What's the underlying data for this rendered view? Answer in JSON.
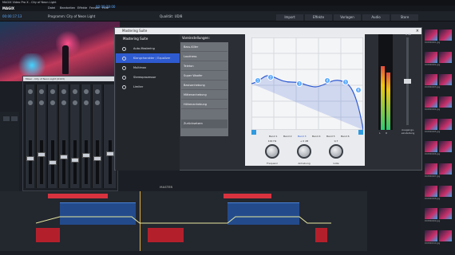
{
  "window": {
    "title": "MAGIX Video Pro X - City of Neon Light",
    "brand": "MAGIX"
  },
  "menu": [
    "Datei",
    "Bearbeiten",
    "Effekte",
    "Fenster",
    "Hilfe"
  ],
  "transport": {
    "timecode_left": "00:00:17:13",
    "program_label": "Programm: City of Neon Light",
    "quality_label": "Qualität: UD/8",
    "timecode_right": "00:00:38:00"
  },
  "top_tabs": [
    "Import",
    "Effekte",
    "Vorlagen",
    "Audio",
    "Store"
  ],
  "mixer": {
    "title": "Mixer - City of Neon Light (0103)",
    "master_label": "MASTER"
  },
  "dialog": {
    "title": "Mastering Suite",
    "nav": [
      {
        "label": "Auto-Mastering",
        "active": false
      },
      {
        "label": "Klangcharakter / Equalizer",
        "active": true
      },
      {
        "label": "Multimax",
        "active": false
      },
      {
        "label": "Stereoprozessor",
        "active": false
      },
      {
        "label": "Limiter",
        "active": false
      }
    ],
    "presets_title": "Voreinstellungen:",
    "presets": [
      "Bass-Killer",
      "Loudness",
      "Teleton",
      "Super Woofer",
      "Basisanhebung",
      "Mittenanhebung",
      "Höhenanhebung",
      "Zurücksetzen"
    ],
    "bands": [
      "Band 1",
      "Band 2",
      "Band 3",
      "Band 4",
      "Band 5",
      "Band 6"
    ],
    "points": [
      "1",
      "2",
      "3",
      "4",
      "5",
      "6"
    ],
    "knobs": [
      {
        "value": "100 Hz",
        "label": "Frequenz"
      },
      {
        "value": "+ 0 dB",
        "label": "Anhebung"
      },
      {
        "value": "0,7",
        "label": "Güte"
      }
    ],
    "meter_top": "0 dB",
    "meter_label": "Ausgangs-einstellung",
    "meter_channels": [
      "L",
      "R"
    ]
  },
  "media": [
    "DCIM00001.jpg",
    "DCIM00002.jpg",
    "DCIM00003.jpg",
    "DCIM00004.jpg",
    "DCIM00005.jpg",
    "DCIM00006.jpg",
    "DCIM00007.jpg",
    "DCIM00008.jpg",
    "DCIM00009.jpg",
    "DCIM00010.jpg",
    "DCIM00011.jpg",
    "DCIM00012.jpg"
  ],
  "colors": {
    "accent": "#2f5bd1",
    "clip_red": "#b3202c",
    "audio_blue": "#234b8c"
  }
}
